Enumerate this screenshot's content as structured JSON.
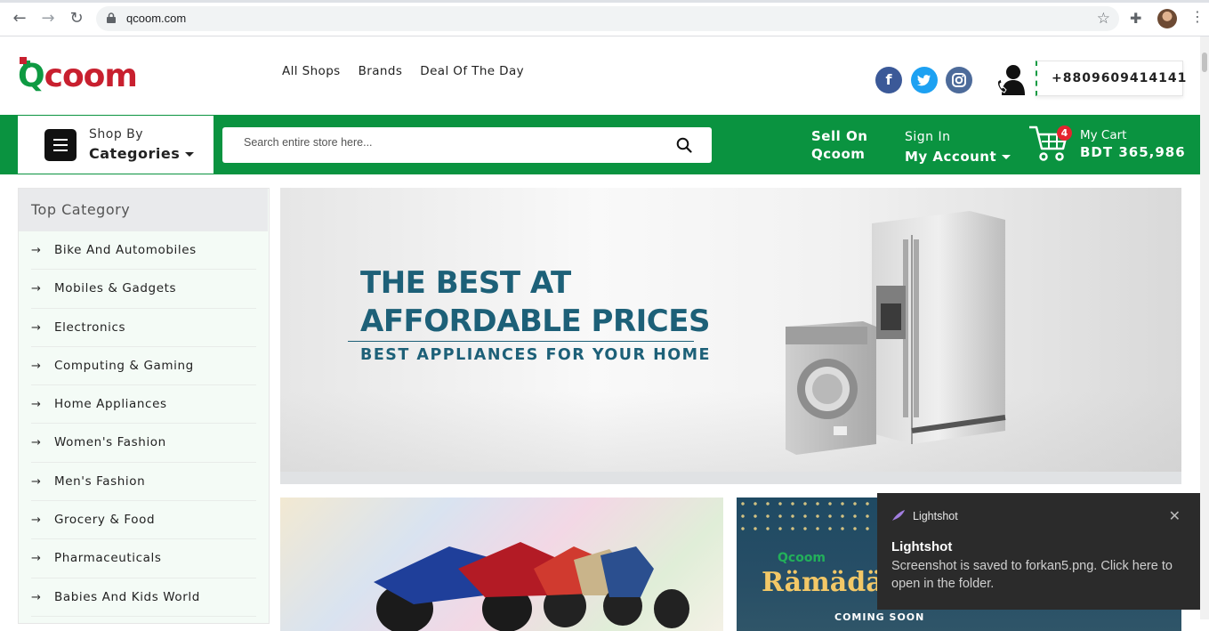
{
  "browser": {
    "url": "qcoom.com",
    "back_icon": "arrow-left-icon",
    "forward_icon": "arrow-right-icon",
    "reload_icon": "reload-icon"
  },
  "header": {
    "logo_q": "Q",
    "logo_rest": "coom",
    "nav": [
      "All Shops",
      "Brands",
      "Deal Of The Day"
    ],
    "social": {
      "facebook": "f",
      "twitter": "t",
      "instagram": "◎"
    },
    "phone": "+8809609414141"
  },
  "bar": {
    "shop_by": "Shop By",
    "categories": "Categories",
    "search_placeholder": "Search entire store here...",
    "sell_line1": "Sell On",
    "sell_line2": "Qcoom",
    "sign_in": "Sign In",
    "my_account": "My Account",
    "cart_count": "4",
    "cart_label": "My Cart",
    "cart_total": "BDT 365,986"
  },
  "sidebar": {
    "title": "Top Category",
    "items": [
      "Bike And Automobiles",
      "Mobiles & Gadgets",
      "Electronics",
      "Computing & Gaming",
      "Home Appliances",
      "Women's Fashion",
      "Men's Fashion",
      "Grocery & Food",
      "Pharmaceuticals",
      "Babies And Kids World"
    ]
  },
  "hero": {
    "line1": "THE BEST AT",
    "line2": "AFFORDABLE PRICES",
    "subline": "BEST APPLIANCES FOR YOUR HOME"
  },
  "promo2": {
    "brand": "Qcoom",
    "title": "Rämädän",
    "soon": "COMING SOON"
  },
  "toast": {
    "app_name": "Lightshot",
    "title": "Lightshot",
    "message": "Screenshot is saved to forkan5.png. Click here to open in the folder."
  },
  "colors": {
    "brand_green": "#0a9340",
    "brand_red": "#c8202f",
    "hero_text": "#1d6078",
    "badge_red": "#e5242f"
  }
}
